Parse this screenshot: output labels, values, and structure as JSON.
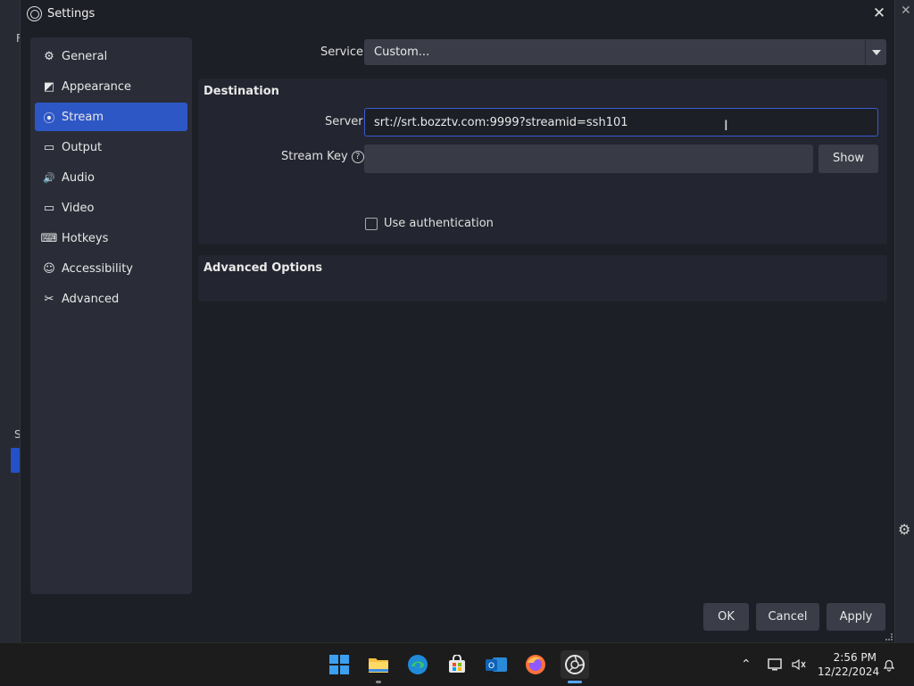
{
  "dialog": {
    "title": "Settings",
    "close_label": "✕"
  },
  "sidebar": {
    "items": [
      {
        "label": "General",
        "icon": "gear-icon",
        "glyph": "⚙"
      },
      {
        "label": "Appearance",
        "icon": "appearance-icon",
        "glyph": "◩"
      },
      {
        "label": "Stream",
        "icon": "broadcast-icon",
        "glyph": "⦿"
      },
      {
        "label": "Output",
        "icon": "output-icon",
        "glyph": "▭"
      },
      {
        "label": "Audio",
        "icon": "speaker-icon",
        "glyph": "🔊"
      },
      {
        "label": "Video",
        "icon": "monitor-icon",
        "glyph": "▭"
      },
      {
        "label": "Hotkeys",
        "icon": "keyboard-icon",
        "glyph": "⌨"
      },
      {
        "label": "Accessibility",
        "icon": "accessibility-icon",
        "glyph": "☺"
      },
      {
        "label": "Advanced",
        "icon": "tools-icon",
        "glyph": "✂"
      }
    ],
    "active_index": 2
  },
  "stream": {
    "service_label": "Service",
    "service_value": "Custom...",
    "destination_title": "Destination",
    "server_label": "Server",
    "server_value": "srt://srt.bozztv.com:9999?streamid=ssh101",
    "stream_key_label": "Stream Key",
    "stream_key_value": "",
    "help_glyph": "?",
    "show_label": "Show",
    "use_auth_label": "Use authentication",
    "use_auth_checked": false,
    "advanced_title": "Advanced Options"
  },
  "footer": {
    "ok_label": "OK",
    "cancel_label": "Cancel",
    "apply_label": "Apply"
  },
  "taskbar": {
    "apps": [
      "start-icon",
      "file-explorer-icon",
      "edge-icon",
      "store-icon",
      "outlook-icon",
      "firefox-icon",
      "obs-icon"
    ],
    "time": "2:56 PM",
    "date": "12/22/2024"
  },
  "colors": {
    "accent": "#2e57c6",
    "background": "#1d1f26"
  }
}
